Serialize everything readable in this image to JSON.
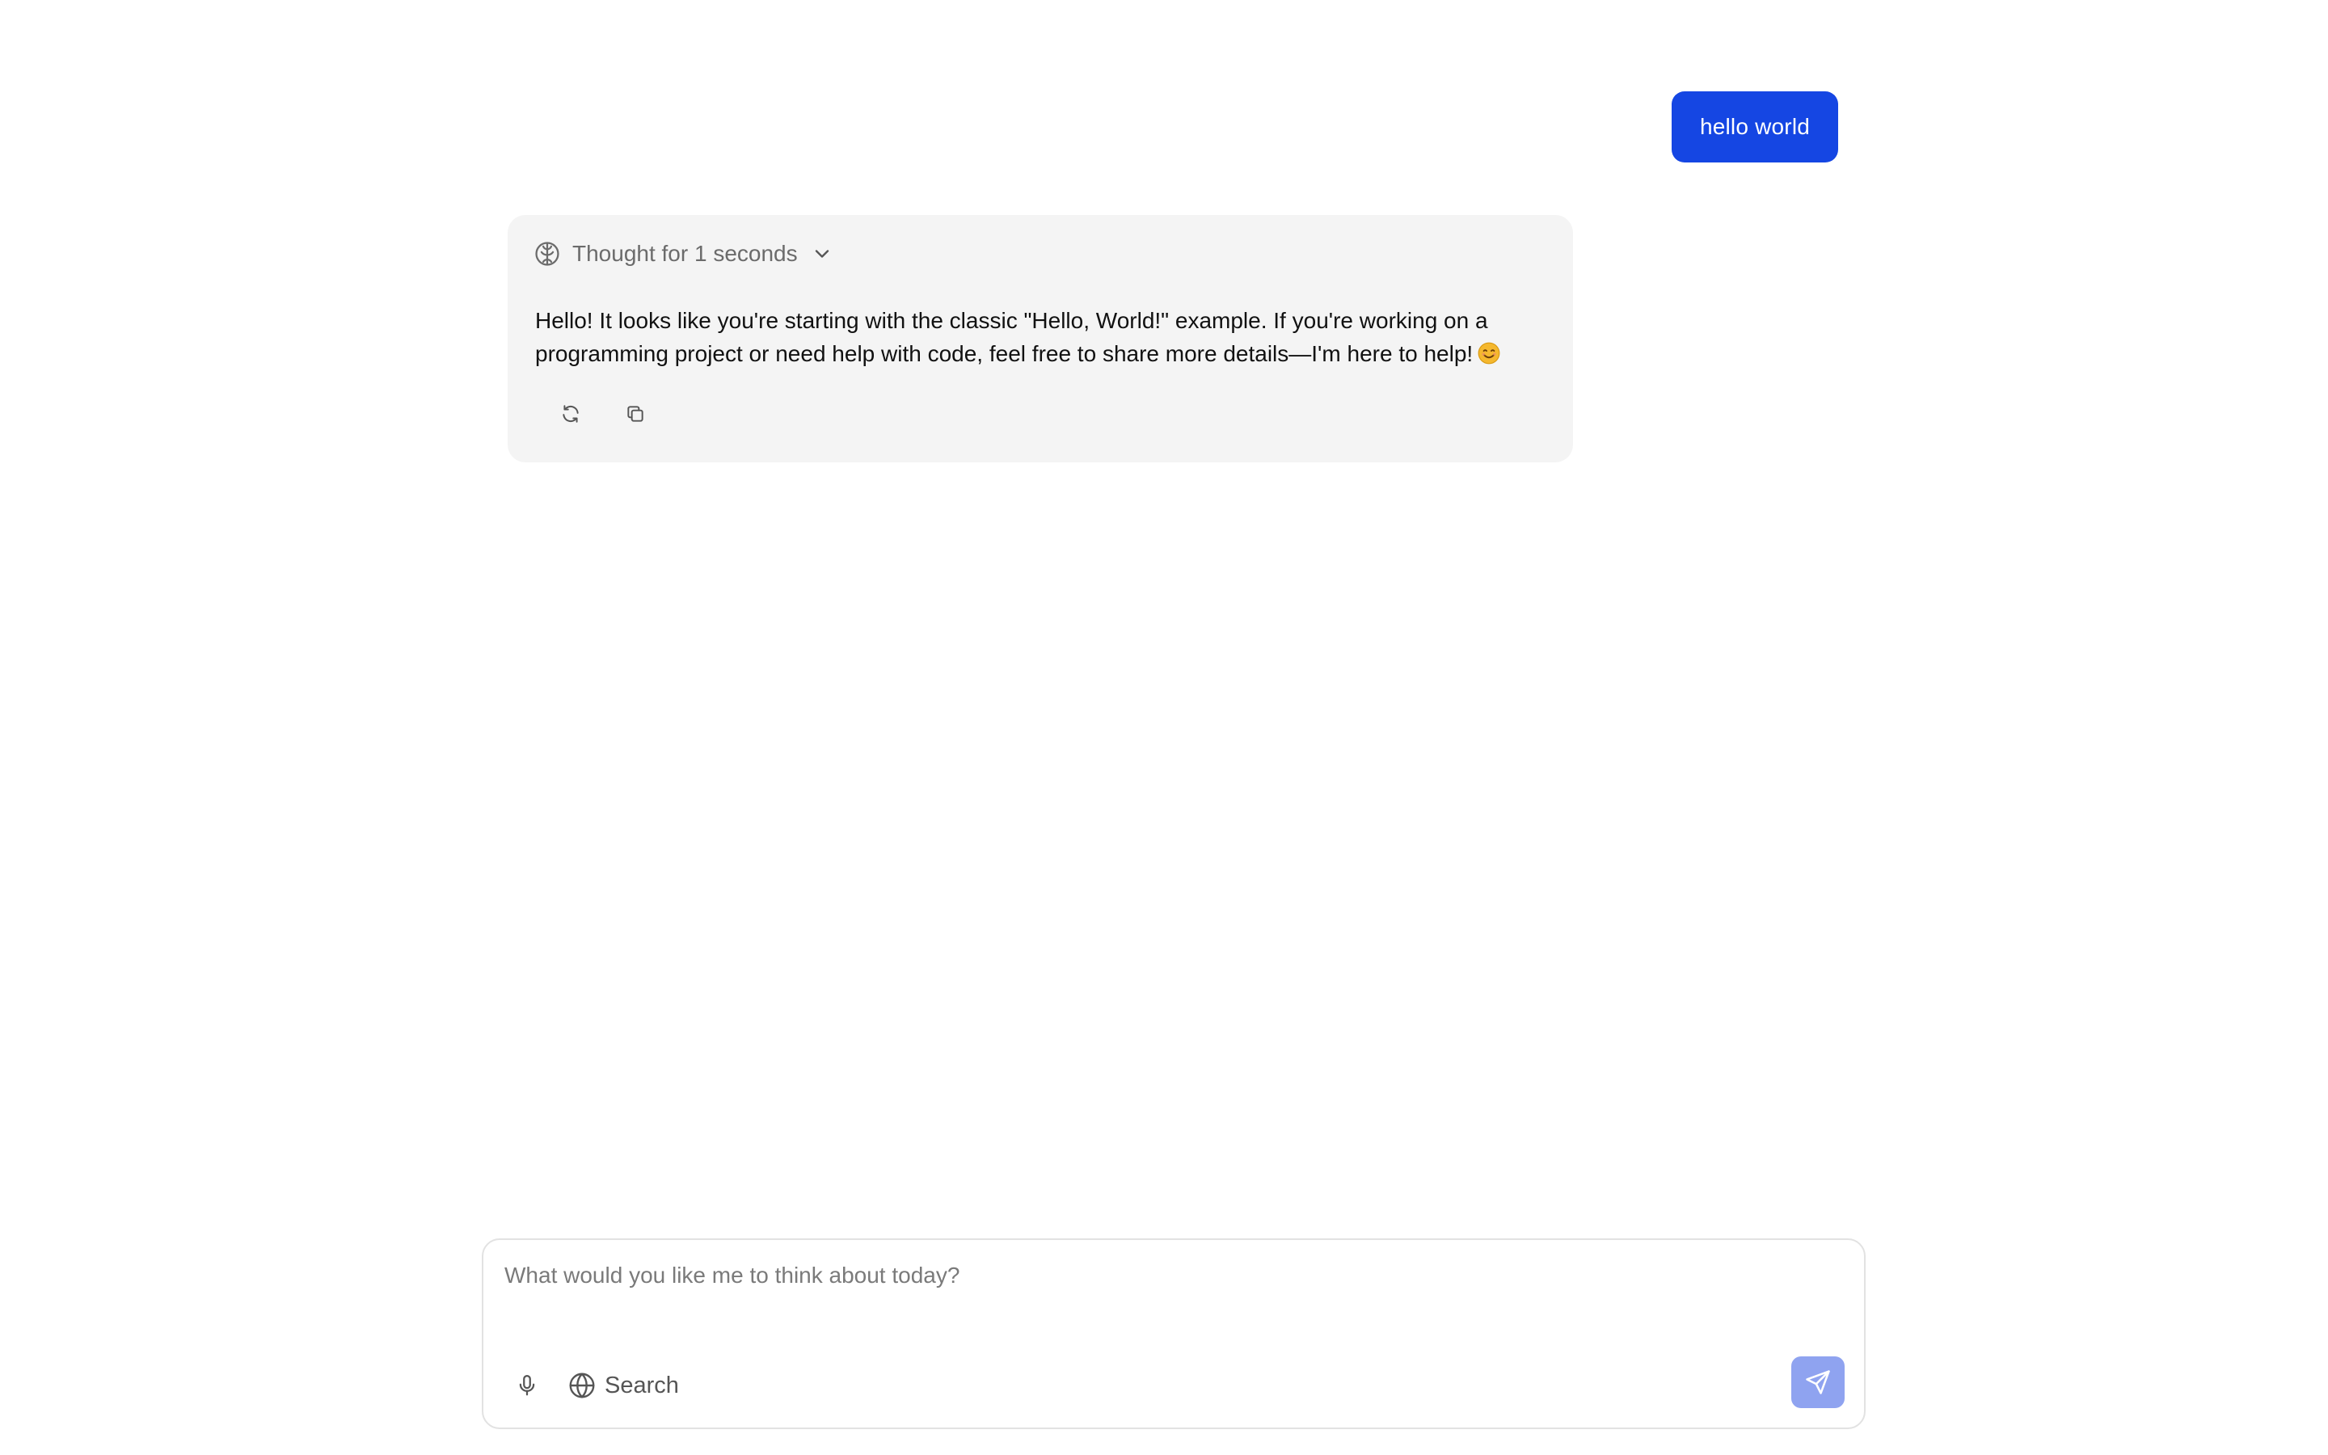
{
  "conversation": {
    "user_message": "hello world",
    "assistant": {
      "thought_label": "Thought for 1 seconds",
      "answer": "Hello! It looks like you're starting with the classic \"Hello, World!\" example. If you're working on a programming project or need help with code, feel free to share more details—I'm here to help!",
      "icons": {
        "thought": "brain-icon",
        "expand": "chevron-down-icon",
        "emoji": "smiling-face-emoji",
        "regenerate": "refresh-icon",
        "copy": "copy-icon"
      }
    }
  },
  "composer": {
    "placeholder": "What would you like me to think about today?",
    "value": "",
    "search_label": "Search",
    "icons": {
      "mic": "microphone-icon",
      "search": "globe-icon",
      "send": "send-icon"
    }
  },
  "colors": {
    "user_bubble": "#1546e3",
    "assistant_card": "#f4f4f4",
    "send_button": "#8fa3f0"
  }
}
